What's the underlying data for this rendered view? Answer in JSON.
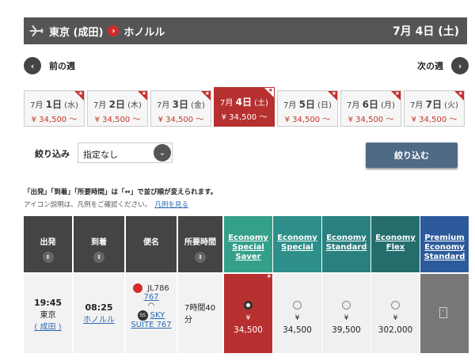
{
  "header": {
    "origin": "東京 (成田)",
    "dest": "ホノルル",
    "date": "7月 4日 (土)"
  },
  "nav": {
    "prev": "前の週",
    "next": "次の週"
  },
  "dates": [
    {
      "date": "7月",
      "day": "1日",
      "dow": "(水)",
      "price": "¥ 34,500 ～"
    },
    {
      "date": "7月",
      "day": "2日",
      "dow": "(木)",
      "price": "¥ 34,500 ～"
    },
    {
      "date": "7月",
      "day": "3日",
      "dow": "(金)",
      "price": "¥ 34,500 ～"
    },
    {
      "date": "7月",
      "day": "4日",
      "dow": "(土)",
      "price": "¥ 34,500 ～"
    },
    {
      "date": "7月",
      "day": "5日",
      "dow": "(日)",
      "price": "¥ 34,500 ～"
    },
    {
      "date": "7月",
      "day": "6日",
      "dow": "(月)",
      "price": "¥ 34,500 ～"
    },
    {
      "date": "7月",
      "day": "7日",
      "dow": "(火)",
      "price": "¥ 34,500 ～"
    }
  ],
  "filter": {
    "label": "絞り込み",
    "value": "指定なし",
    "apply": "絞り込む"
  },
  "notes": {
    "line1": "「出発」「到着」「所要時間」は「⇔」で並び順が変えられます。",
    "line2": "アイコン説明は、凡例をご確認ください。",
    "link": "凡例を見る"
  },
  "columns": {
    "dep": "出発",
    "arr": "到着",
    "flight": "便名",
    "duration": "所要時間"
  },
  "fares": [
    {
      "l1": "Economy",
      "l2": "Special",
      "l3": "Saver",
      "color": "#35a08a"
    },
    {
      "l1": "Economy",
      "l2": "Special",
      "l3": "",
      "color": "#2e8f8a"
    },
    {
      "l1": "Economy",
      "l2": "Standard",
      "l3": "",
      "color": "#2a7f7f"
    },
    {
      "l1": "Economy",
      "l2": "Flex",
      "l3": "",
      "color": "#256d6d"
    },
    {
      "l1": "Premium",
      "l2": "Economy",
      "l3": "Standard",
      "color": "#2d5a9a"
    }
  ],
  "row": {
    "dep_time": "19:45",
    "dep_city": "東京",
    "dep_airport": "( 成田 )",
    "arr_time": "08:25",
    "arr_city": "ホノルル",
    "flight_no": "JL786",
    "flight_num": "767",
    "aircraft1": "SKY",
    "aircraft2": "SUITE 767",
    "duration1": "7時間40",
    "duration2": "分",
    "prices": [
      "34,500",
      "34,500",
      "39,500",
      "302,000"
    ],
    "yen": "¥"
  }
}
